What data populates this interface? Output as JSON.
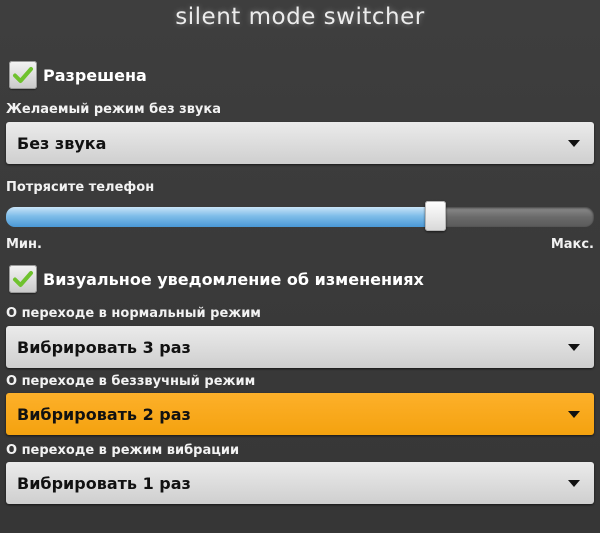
{
  "app": {
    "title": "silent mode switcher"
  },
  "enabled": {
    "label": "Разрешена",
    "checked": true
  },
  "silent_mode": {
    "label": "Желаемый режим без звука",
    "value": "Без звука"
  },
  "shake": {
    "label": "Потрясите телефон",
    "min_label": "Мин.",
    "max_label": "Макс.",
    "level": 0.73
  },
  "visual_notify": {
    "label": "Визуальное уведомление об изменениях",
    "checked": true
  },
  "to_normal": {
    "label": "О переходе в нормальный режим",
    "value": "Вибрировать 3 раз"
  },
  "to_silent": {
    "label": "О переходе в беззвучный режим",
    "value": "Вибрировать 2 раз"
  },
  "to_vibrate": {
    "label": "О переходе в режим вибрации",
    "value": "Вибрировать 1 раз"
  },
  "colors": {
    "accent": "#f7a616",
    "slider_fill": "#6fb3e6",
    "check": "#6fc22e",
    "background": "#3b3b3b"
  }
}
